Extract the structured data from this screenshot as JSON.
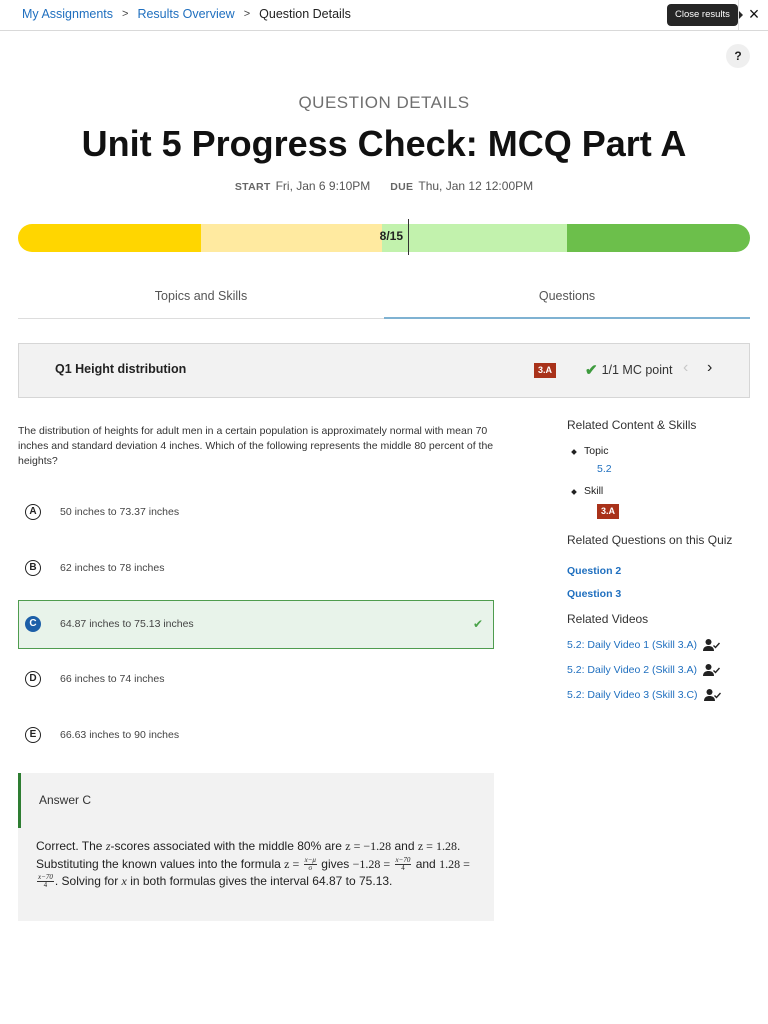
{
  "breadcrumb": {
    "items": [
      "My Assignments",
      "Results Overview"
    ],
    "current": "Question Details",
    "separator": ">"
  },
  "topbar": {
    "tooltip": "Close results",
    "close_icon": "×",
    "help_label": "?"
  },
  "header": {
    "eyebrow": "QUESTION DETAILS",
    "title": "Unit 5 Progress Check: MCQ Part A",
    "start_label": "START",
    "start_value": "Fri, Jan 6 9:10PM",
    "due_label": "DUE",
    "due_value": "Thu, Jan 12 12:00PM"
  },
  "score": {
    "label": "8/15",
    "earned": 8,
    "total": 15,
    "colors": [
      "#ffd600",
      "#ffeaa0",
      "#c2f2ad",
      "#6cbf4b"
    ]
  },
  "tabs": [
    {
      "label": "Topics and Skills",
      "active": false
    },
    {
      "label": "Questions",
      "active": true
    }
  ],
  "question": {
    "title": "Q1 Height distribution",
    "skill": "3.A",
    "points": "1/1 MC point",
    "prev_icon": "‹",
    "next_icon": "›",
    "stem": "The distribution of heights for adult men in a certain population is approximately normal with mean 70 inches and standard deviation 4 inches. Which of the following represents the middle 80 percent of the heights?",
    "choices": [
      {
        "letter": "A",
        "text": "50 inches to 73.37 inches",
        "correct": false
      },
      {
        "letter": "B",
        "text": "62 inches to 78 inches",
        "correct": false
      },
      {
        "letter": "C",
        "text": "64.87 inches to 75.13 inches",
        "correct": true
      },
      {
        "letter": "D",
        "text": "66 inches to 74 inches",
        "correct": false
      },
      {
        "letter": "E",
        "text": "66.63 inches to 90 inches",
        "correct": false
      }
    ],
    "correct_check": "✔"
  },
  "answer": {
    "title": "Answer C",
    "exp": {
      "p1": "Correct. The ",
      "z": "z",
      "p2": "-scores associated with the middle 80% are ",
      "eq1": "z = −1.28",
      "p3": " and ",
      "eq2": "z = 1.28",
      "p4": ". Substituting the known values into the formula ",
      "eq3": "z =",
      "f1_num": "x−μ",
      "f1_den": "σ",
      "p5": " gives ",
      "eq4": "−1.28 =",
      "f2_num": "x−70",
      "f2_den": "4",
      "p6": " and ",
      "eq5": "1.28 =",
      "f3_num": "x−70",
      "f3_den": "4",
      "p7": ". Solving for ",
      "x": "x",
      "p8": " in both formulas gives the interval 64.87 to 75.13."
    }
  },
  "sidebar": {
    "related_content_heading": "Related Content & Skills",
    "topic_label": "Topic",
    "topic_value": "5.2",
    "skill_label": "Skill",
    "skill_value": "3.A",
    "related_questions_heading": "Related Questions on this Quiz",
    "related_questions": [
      "Question 2",
      "Question 3"
    ],
    "related_videos_heading": "Related Videos",
    "videos": [
      "5.2: Daily Video 1 (Skill 3.A)",
      "5.2: Daily Video 2 (Skill 3.A)",
      "5.2: Daily Video 3 (Skill 3.C)"
    ]
  }
}
